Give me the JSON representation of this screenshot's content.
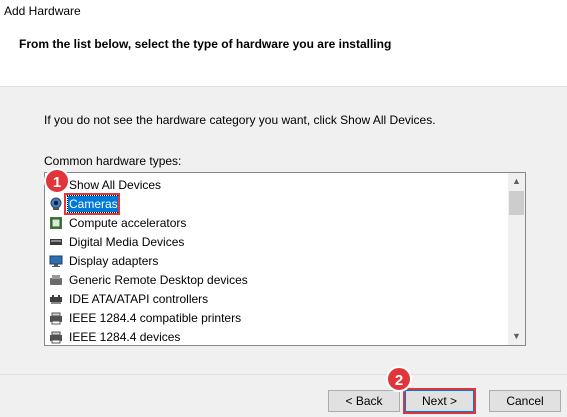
{
  "window": {
    "title": "Add Hardware"
  },
  "header": {
    "subtitle": "From the list below, select the type of hardware you are installing"
  },
  "instruction": "If you do not see the hardware category you want, click Show All Devices.",
  "list": {
    "label": "Common hardware types:",
    "items": [
      {
        "label": "Show All Devices",
        "icon": "show-all-devices-icon",
        "selected": false
      },
      {
        "label": "Cameras",
        "icon": "camera-icon",
        "selected": true
      },
      {
        "label": "Compute accelerators",
        "icon": "chip-icon",
        "selected": false
      },
      {
        "label": "Digital Media Devices",
        "icon": "media-device-icon",
        "selected": false
      },
      {
        "label": "Display adapters",
        "icon": "display-adapter-icon",
        "selected": false
      },
      {
        "label": "Generic Remote Desktop devices",
        "icon": "remote-desktop-icon",
        "selected": false
      },
      {
        "label": "IDE ATA/ATAPI controllers",
        "icon": "ide-controller-icon",
        "selected": false
      },
      {
        "label": "IEEE 1284.4 compatible printers",
        "icon": "printer-icon",
        "selected": false
      },
      {
        "label": "IEEE 1284.4 devices",
        "icon": "printer-device-icon",
        "selected": false
      }
    ]
  },
  "buttons": {
    "back": "< Back",
    "next": "Next >",
    "cancel": "Cancel"
  },
  "annotations": {
    "step1": "1",
    "step2": "2"
  },
  "colors": {
    "selection": "#0078d7",
    "annotation": "#e0353a"
  }
}
